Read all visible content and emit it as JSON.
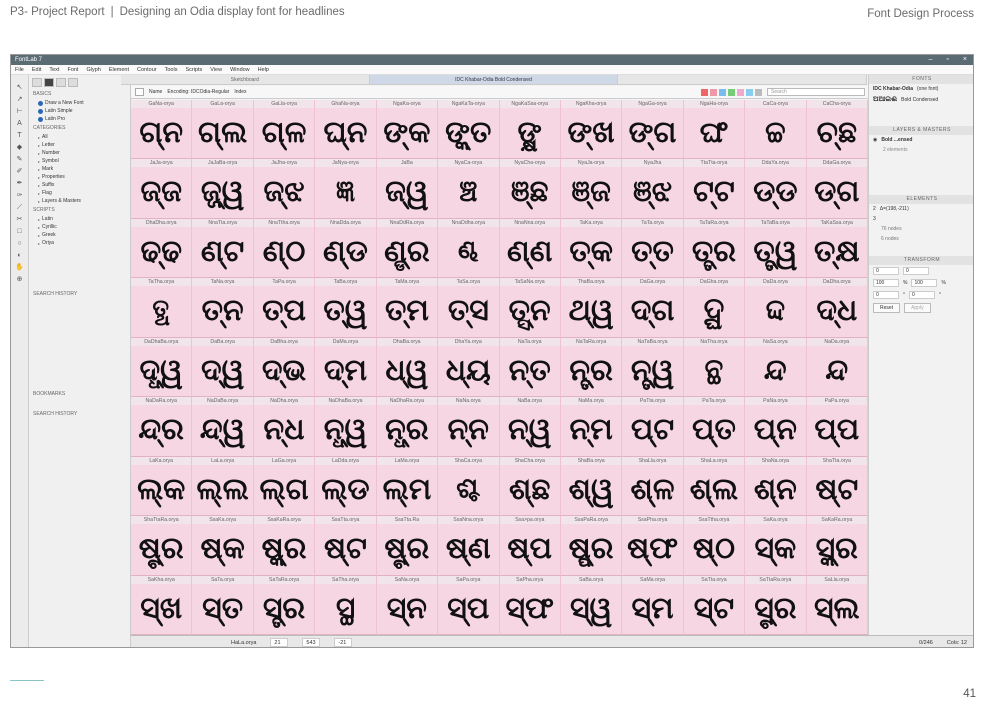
{
  "page": {
    "header": "P3- Project Report",
    "separator": "|",
    "subtitle": "Designing an Odia display font for headlines",
    "right_title": "Font Design Process",
    "page_number": "41"
  },
  "app": {
    "window_title": "FontLab 7",
    "menu": [
      "File",
      "Edit",
      "Text",
      "Font",
      "Glyph",
      "Element",
      "Contour",
      "Tools",
      "Scripts",
      "View",
      "Window",
      "Help"
    ],
    "tabs": [
      "Sketchboard",
      "IDC Khabar-Odia Bold Condensed",
      ""
    ],
    "toolbar": {
      "name_label": "Name",
      "encoding_label": "Encoding: IDCOdia-Regular",
      "index_label": "Index",
      "search_placeholder": "Search",
      "swatches": [
        "#ee6666",
        "#ee99aa",
        "#7bbbee",
        "#77cc77",
        "#eeaacc",
        "#88ccee",
        "#bbbbbb"
      ]
    },
    "left_panel": {
      "basics_title": "BASICS",
      "basics": [
        "Draw a New Font",
        "Latin Simple",
        "Latin Pro"
      ],
      "categories_title": "CATEGORIES",
      "categories": [
        "All",
        "Letter",
        "Number",
        "Symbol",
        "Mark",
        "Properties",
        "Suffix",
        "Flag",
        "Layers & Masters"
      ],
      "scripts_title": "SCRIPTS",
      "scripts": [
        "Latin",
        "Cyrillic",
        "Greek",
        "Oriya"
      ],
      "search_history_1": "SEARCH HISTORY",
      "bookmarks": "BOOKMARKS",
      "search_history_2": "SEARCH HISTORY"
    },
    "glyphs": [
      {
        "n": "GaNa-orya",
        "g": "ଗ୍ନ"
      },
      {
        "n": "GaLa-orya",
        "g": "ଗ୍ଲ"
      },
      {
        "n": "GaLla-orya",
        "g": "ଗ୍ଳ"
      },
      {
        "n": "GhaNa-orya",
        "g": "ଘ୍ନ"
      },
      {
        "n": "NgaKa-orya",
        "g": "ଙ୍କ"
      },
      {
        "n": "NgaKaTa-orya",
        "g": "ଙ୍କ୍ତ"
      },
      {
        "n": "NgaKaSsa-orya",
        "g": "ଙ୍କ୍ଷ"
      },
      {
        "n": "NgaKha-orya",
        "g": "ଙ୍ଖ"
      },
      {
        "n": "NgaGa-orya",
        "g": "ଙ୍ଗ"
      },
      {
        "n": "NgaHa-orya",
        "g": "ଙ୍ଘ"
      },
      {
        "n": "CaCa-orya",
        "g": "ଚ୍ଚ"
      },
      {
        "n": "CaCha-orya",
        "g": "ଚ୍ଛ"
      },
      {
        "n": "JaJa-orya",
        "g": "ଜ୍ଜ"
      },
      {
        "n": "JaJaBa-orya",
        "g": "ଜ୍ଜ୍ୱ"
      },
      {
        "n": "JaJha-orya",
        "g": "ଜ୍ଝ"
      },
      {
        "n": "JaNya-orya",
        "g": "ଜ୍ଞ"
      },
      {
        "n": "JaBa",
        "g": "ଜ୍ୱ"
      },
      {
        "n": "NyaCa-orya",
        "g": "ଞ୍ଚ"
      },
      {
        "n": "NyaCha-orya",
        "g": "ଞ୍ଛ"
      },
      {
        "n": "NyaJa-orya",
        "g": "ଞ୍ଜ"
      },
      {
        "n": "NyaJha",
        "g": "ଞ୍ଝ"
      },
      {
        "n": "TtaTta-orya",
        "g": "ଟ୍ଟ"
      },
      {
        "n": "DdaYa.orya",
        "g": "ଡ୍ଡ"
      },
      {
        "n": "DdaGa.orya",
        "g": "ଡ୍ଗ"
      },
      {
        "n": "DhaDha.orya",
        "g": "ଢ୍ଢ"
      },
      {
        "n": "NnaTta.orya",
        "g": "ଣ୍ଟ"
      },
      {
        "n": "NnaTtha.orya",
        "g": "ଣ୍ଠ"
      },
      {
        "n": "NnaDda.orya",
        "g": "ଣ୍ଡ"
      },
      {
        "n": "NnaDdRa.orya",
        "g": "ଣ୍ଡ୍ର"
      },
      {
        "n": "NnaDdha.orya",
        "g": "ଣ୍ଢ"
      },
      {
        "n": "NnaNna.orya",
        "g": "ଣ୍ଣ"
      },
      {
        "n": "TaKa.orya",
        "g": "ତ୍କ"
      },
      {
        "n": "TaTa.orya",
        "g": "ତ୍ତ"
      },
      {
        "n": "TaTaRa.orya",
        "g": "ତ୍ତ୍ର"
      },
      {
        "n": "TaTaBa.orya",
        "g": "ତ୍ତ୍ୱ"
      },
      {
        "n": "TaKaSsa.orya",
        "g": "ତ୍କ୍ଷ"
      },
      {
        "n": "TaTha.orya",
        "g": "ତ୍ଥ"
      },
      {
        "n": "TaNa.orya",
        "g": "ତ୍ନ"
      },
      {
        "n": "TaPa.orya",
        "g": "ତ୍ପ"
      },
      {
        "n": "TaBa.orya",
        "g": "ତ୍ୱ"
      },
      {
        "n": "TaMa.orya",
        "g": "ତ୍ମ"
      },
      {
        "n": "TaSa.orya",
        "g": "ତ୍ସ"
      },
      {
        "n": "TaSaNa.orya",
        "g": "ତ୍ସ୍ନ"
      },
      {
        "n": "ThaBa.orya",
        "g": "ଥ୍ୱ"
      },
      {
        "n": "DaGa.orya",
        "g": "ଦ୍ଗ"
      },
      {
        "n": "DaGha.orya",
        "g": "ଦ୍ଘ"
      },
      {
        "n": "DaDa.orya",
        "g": "ଦ୍ଦ"
      },
      {
        "n": "DaDha.orya",
        "g": "ଦ୍ଧ"
      },
      {
        "n": "DaDhaBa.orya",
        "g": "ଦ୍ଧ୍ୱ"
      },
      {
        "n": "DaBa.orya",
        "g": "ଦ୍ୱ"
      },
      {
        "n": "DaBha.orya",
        "g": "ଦ୍ଭ"
      },
      {
        "n": "DaMa.orya",
        "g": "ଦ୍ମ"
      },
      {
        "n": "DhaBa.orya",
        "g": "ଧ୍ୱ"
      },
      {
        "n": "DhaYa.orya",
        "g": "ଧ୍ୟ"
      },
      {
        "n": "NaTa.orya",
        "g": "ନ୍ତ"
      },
      {
        "n": "NaTaRa.orya",
        "g": "ନ୍ତ୍ର"
      },
      {
        "n": "NaTaBa.orya",
        "g": "ନ୍ତ୍ୱ"
      },
      {
        "n": "NaTha.orya",
        "g": "ନ୍ଥ"
      },
      {
        "n": "NaSa.orya",
        "g": "ନ୍ଦ"
      },
      {
        "n": "NaDa.orya",
        "g": "ନ୍ଦ"
      },
      {
        "n": "NaDaRa.orya",
        "g": "ନ୍ଦ୍ର"
      },
      {
        "n": "NaDaBa.orya",
        "g": "ନ୍ଦ୍ୱ"
      },
      {
        "n": "NaDha.orya",
        "g": "ନ୍ଧ"
      },
      {
        "n": "NaDhaBa.orya",
        "g": "ନ୍ଧ୍ୱ"
      },
      {
        "n": "NaDhaRa.orya",
        "g": "ନ୍ଧ୍ର"
      },
      {
        "n": "NaNa.orya",
        "g": "ନ୍ନ"
      },
      {
        "n": "NaBa.orya",
        "g": "ନ୍ୱ"
      },
      {
        "n": "NaMa.orya",
        "g": "ନ୍ମ"
      },
      {
        "n": "PaTta.orya",
        "g": "ପ୍ଟ"
      },
      {
        "n": "PaTa.orya",
        "g": "ପ୍ତ"
      },
      {
        "n": "PaNa.orya",
        "g": "ପ୍ନ"
      },
      {
        "n": "PaPa.orya",
        "g": "ପ୍ପ"
      },
      {
        "n": "LaKa.orya",
        "g": "ଲ୍କ"
      },
      {
        "n": "LaLa.orya",
        "g": "ଲ୍ଲ"
      },
      {
        "n": "LaGa.orya",
        "g": "ଲ୍ଗ"
      },
      {
        "n": "LaDda.orya",
        "g": "ଲ୍ଡ"
      },
      {
        "n": "LaMa.orya",
        "g": "ଲ୍ମ"
      },
      {
        "n": "ShaCa.orya",
        "g": "ଶ୍ଚ"
      },
      {
        "n": "ShaCha.orya",
        "g": "ଶ୍ଛ"
      },
      {
        "n": "ShaBa.orya",
        "g": "ଶ୍ୱ"
      },
      {
        "n": "ShaLla.orya",
        "g": "ଶ୍ଳ"
      },
      {
        "n": "ShaLa.orya",
        "g": "ଶ୍ଲ"
      },
      {
        "n": "ShaNa.orya",
        "g": "ଶ୍ନ"
      },
      {
        "n": "ShaTta.orya",
        "g": "ଷ୍ଟ"
      },
      {
        "n": "ShaTtaRa.orya",
        "g": "ଷ୍ଟ୍ର"
      },
      {
        "n": "SsaKa.orya",
        "g": "ଷ୍କ"
      },
      {
        "n": "SsaKaRa.orya",
        "g": "ଷ୍କ୍ର"
      },
      {
        "n": "SsaTta.orya",
        "g": "ଷ୍ଟ"
      },
      {
        "n": "SsaTta.Ra",
        "g": "ଷ୍ଟ୍ର"
      },
      {
        "n": "SsaNna.orya",
        "g": "ଷ୍ଣ"
      },
      {
        "n": "Ssa>pa.orya",
        "g": "ଷ୍ପ"
      },
      {
        "n": "SsaPaRa.orya",
        "g": "ଷ୍ପ୍ର"
      },
      {
        "n": "SsaPha.orya",
        "g": "ଷ୍ଫ"
      },
      {
        "n": "SsaTtha.orya",
        "g": "ଷ୍ଠ"
      },
      {
        "n": "SaKa.orya",
        "g": "ସ୍କ"
      },
      {
        "n": "SaKaRa.orya",
        "g": "ସ୍କ୍ର"
      },
      {
        "n": "SaKha.orya",
        "g": "ସ୍ଖ"
      },
      {
        "n": "SaTa.orya",
        "g": "ସ୍ତ"
      },
      {
        "n": "SaTaRa.orya",
        "g": "ସ୍ତ୍ର"
      },
      {
        "n": "SaTha.orya",
        "g": "ସ୍ଥ"
      },
      {
        "n": "SaNa.orya",
        "g": "ସ୍ନ"
      },
      {
        "n": "SaPa.orya",
        "g": "ସ୍ପ"
      },
      {
        "n": "SaPha.orya",
        "g": "ସ୍ଫ"
      },
      {
        "n": "SaBa.orya",
        "g": "ସ୍ୱ"
      },
      {
        "n": "SaMa.orya",
        "g": "ସ୍ମ"
      },
      {
        "n": "SaTta.orya",
        "g": "ସ୍ଟ"
      },
      {
        "n": "SaTtaRa.orya",
        "g": "ସ୍ଟ୍ର"
      },
      {
        "n": "SaLla.orya",
        "g": "ସ୍ଲ"
      }
    ],
    "right_panel": {
      "fonts_title": "FONTS",
      "font_family": "IDC Khabar-Odia",
      "font_count": "(one font)",
      "font_style": "Bold Condensed",
      "font_preview": "ଅଆଇଈ",
      "layers_title": "LAYERS & MASTERS",
      "layer_name": "Bold ...ensed",
      "layer_sub": "2 elements",
      "elements_title": "ELEMENTS",
      "el1": "2",
      "el1b": "Δ=(198,-211)",
      "el2": "3",
      "nodes1": "76 nodes",
      "nodes2": "6 nodes",
      "transform_title": "TRANSFORM",
      "x": "0",
      "y": "0",
      "w": "100",
      "h": "100",
      "pct": "%",
      "r1": "0",
      "r2": "0",
      "deg": "°",
      "reset": "Reset",
      "apply": "Apply"
    },
    "status": {
      "glyph_name": "HaLa.orya",
      "v1": "21",
      "v2": "543",
      "v3": "-21",
      "count": "0/246",
      "cols": "Cols: 12"
    }
  }
}
